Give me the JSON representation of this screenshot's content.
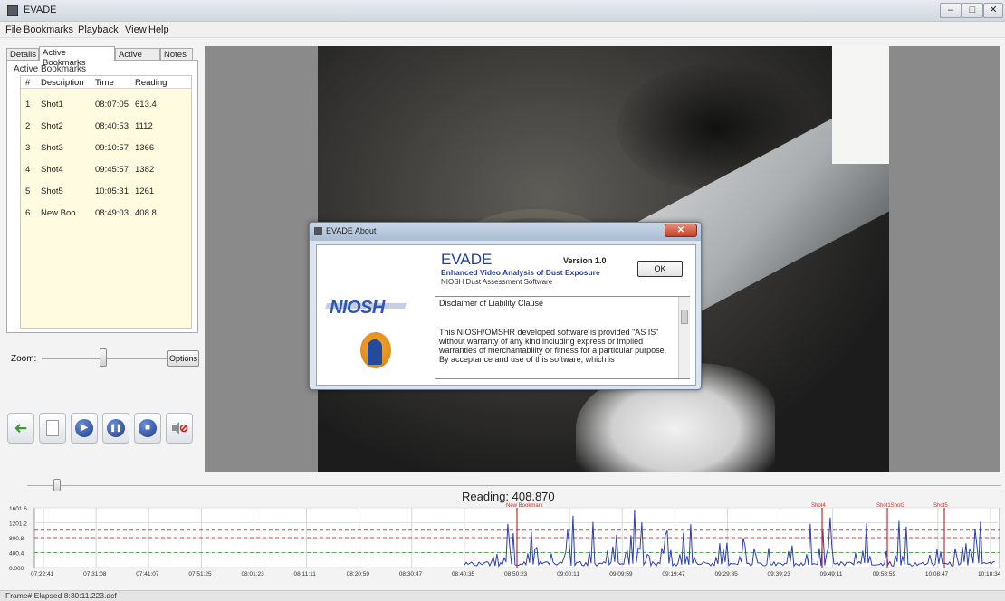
{
  "window": {
    "title": "EVADE",
    "minimize": "–",
    "maximize": "□",
    "close": "✕"
  },
  "menu": [
    "File",
    "Bookmarks",
    "Playback",
    "View",
    "Help"
  ],
  "tabs": [
    "Details",
    "Active Bookmarks",
    "Active Files",
    "Notes"
  ],
  "bookmarks": {
    "group_label": "Active Bookmarks",
    "columns": [
      "#",
      "Description",
      "Time",
      "Reading"
    ],
    "rows": [
      [
        "1",
        "Shot1",
        "08:07:05",
        "613.4"
      ],
      [
        "2",
        "Shot2",
        "08:40:53",
        "1112"
      ],
      [
        "3",
        "Shot3",
        "09:10:57",
        "1366"
      ],
      [
        "4",
        "Shot4",
        "09:45:57",
        "1382"
      ],
      [
        "5",
        "Shot5",
        "10:05:31",
        "1261"
      ],
      [
        "6",
        "New Boo",
        "08:49:03",
        "408.8"
      ]
    ]
  },
  "zoom": {
    "label": "Zoom:",
    "options_label": "Options"
  },
  "toolbar": {
    "icons": [
      "back-arrow-icon",
      "document-icon",
      "play-icon",
      "pause-icon",
      "stop-icon",
      "mute-icon"
    ],
    "glyphs": [
      "➜",
      "",
      "▶",
      "❚❚",
      "■",
      "🔇"
    ]
  },
  "dialog": {
    "title": "EVADE About",
    "close": "✕",
    "app_name": "EVADE",
    "version": "Version 1.0",
    "app_full_name": "Enhanced Video Analysis of Dust Exposure",
    "app_desc": "NIOSH Dust Assessment Software",
    "ok_label": "OK",
    "logo_text": "NIOSH",
    "disclaimer_title": "Disclaimer of Liability Clause",
    "disclaimer_text": "This NIOSH/OMSHR developed software is provided \"AS IS\" without warranty of any kind including express or implied warranties of merchantability or fitness for a particular purpose. By acceptance and use of this software, which is"
  },
  "reading": {
    "label": "Reading: 408.870"
  },
  "chart_data": {
    "type": "line",
    "y_ticks": [
      "1601.6",
      "1201.2",
      "800.8",
      "400.4",
      "0.000"
    ],
    "x_ticks": [
      "07:22:41",
      "07:31:08",
      "07:41:07",
      "07:51:25",
      "08:01:23",
      "08:11:11",
      "08:20:59",
      "08:30:47",
      "08:40:35",
      "08:50:23",
      "09:00:11",
      "09:09:59",
      "09:19:47",
      "09:29:35",
      "09:39:23",
      "09:49:11",
      "09:58:59",
      "10:08:47",
      "10:18:34"
    ],
    "ylim": [
      0,
      1601.6
    ],
    "series_color": "#2b3fb3",
    "threshold_lines": [
      {
        "value": 1000,
        "color": "#d94040"
      },
      {
        "value": 800,
        "color": "#d94040"
      },
      {
        "value": 400,
        "color": "#5aaa5a"
      }
    ],
    "event_markers": [
      "New Bookmark",
      "Shot4",
      "Shot1Shot3",
      "Shot5"
    ]
  },
  "status": {
    "text": "Frame# Elapsed 8:30:11.223.dcf"
  }
}
